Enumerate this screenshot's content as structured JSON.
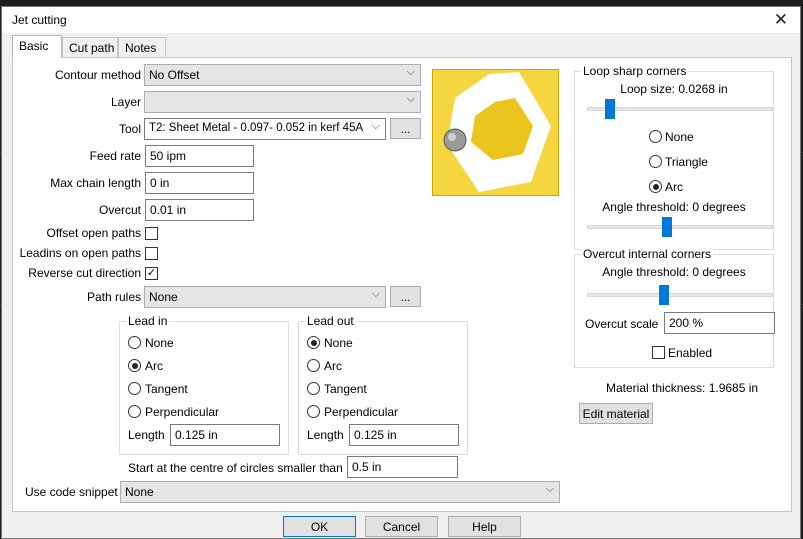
{
  "window": {
    "title": "Jet cutting",
    "close_icon": "close-icon"
  },
  "tabs": [
    {
      "label": "Basic",
      "active": true
    },
    {
      "label": "Cut path",
      "active": false
    },
    {
      "label": "Notes",
      "active": false
    }
  ],
  "basic": {
    "contour_method": {
      "label": "Contour method",
      "value": "No Offset"
    },
    "layer": {
      "label": "Layer",
      "value": ""
    },
    "tool": {
      "label": "Tool",
      "value": "T2: Sheet Metal - 0.097- 0.052 in kerf 45A",
      "browse_label": "..."
    },
    "feed_rate": {
      "label": "Feed rate",
      "value": "50 ipm"
    },
    "max_chain_length": {
      "label": "Max chain length",
      "value": "0 in"
    },
    "overcut": {
      "label": "Overcut",
      "value": "0.01 in"
    },
    "offset_open_paths": {
      "label": "Offset open paths",
      "checked": false
    },
    "leadins_on_open_paths": {
      "label": "Leadins on open paths",
      "checked": false
    },
    "reverse_cut_direction": {
      "label": "Reverse cut direction",
      "checked": true,
      "mark": "✓"
    },
    "path_rules": {
      "label": "Path rules",
      "value": "None",
      "browse_label": "..."
    },
    "lead_in": {
      "title": "Lead in",
      "options": [
        "None",
        "Arc",
        "Tangent",
        "Perpendicular"
      ],
      "selected": "Arc",
      "length_label": "Length",
      "length_value": "0.125 in"
    },
    "lead_out": {
      "title": "Lead out",
      "options": [
        "None",
        "Arc",
        "Tangent",
        "Perpendicular"
      ],
      "selected": "None",
      "length_label": "Length",
      "length_value": "0.125 in"
    },
    "start_centre": {
      "label": "Start at the centre of circles smaller than",
      "value": "0.5 in"
    },
    "code_snippet": {
      "label": "Use code snippet",
      "value": "None"
    }
  },
  "loop_sharp_corners": {
    "title": "Loop sharp corners",
    "loop_size_label": "Loop size: 0.0268 in",
    "loop_size_level": 0.09,
    "options": [
      "None",
      "Triangle",
      "Arc"
    ],
    "selected": "Arc",
    "angle_label": "Angle threshold: 0 degrees",
    "angle_level": 0.43
  },
  "overcut_internal_corners": {
    "title": "Overcut internal corners",
    "angle_label": "Angle threshold: 0 degrees",
    "angle_level": 0.43,
    "overcut_scale_label": "Overcut scale",
    "overcut_scale_value": "200 %",
    "enabled_label": "Enabled",
    "enabled_checked": false
  },
  "material": {
    "thickness_label": "Material thickness: 1.9685 in",
    "edit_label": "Edit material"
  },
  "footer": {
    "ok": "OK",
    "cancel": "Cancel",
    "help": "Help"
  },
  "colors": {
    "accent": "#0078d7",
    "preview_bg": "#f5d63f",
    "preview_shape": "#eac51e"
  }
}
